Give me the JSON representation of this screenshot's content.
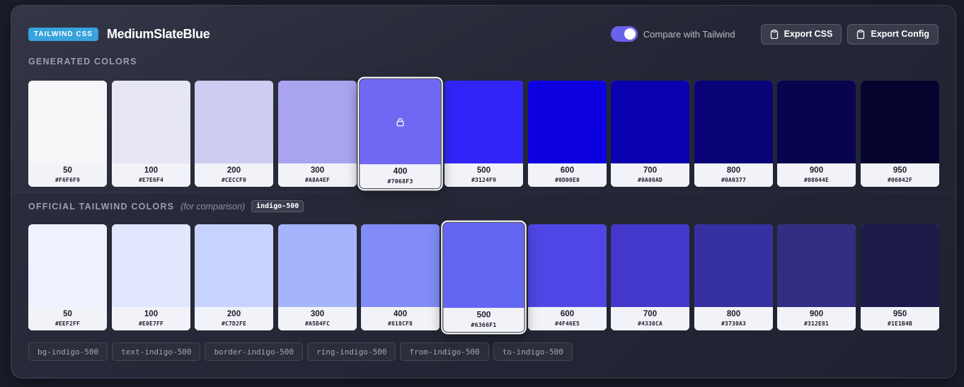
{
  "header": {
    "badge": "TAILWIND CSS",
    "title": "MediumSlateBlue",
    "toggle_label": "Compare with Tailwind",
    "toggle_on": true,
    "export_css": "Export CSS",
    "export_config": "Export Config"
  },
  "colors": {
    "accent": "#6a62ec",
    "badge": "#38a3dd"
  },
  "generated": {
    "label": "GENERATED COLORS",
    "swatches": [
      {
        "shade": "50",
        "hex": "#F6F6F9",
        "color": "#F6F6F9"
      },
      {
        "shade": "100",
        "hex": "#E7E6F4",
        "color": "#E7E6F4"
      },
      {
        "shade": "200",
        "hex": "#CECCF0",
        "color": "#CECCF0"
      },
      {
        "shade": "300",
        "hex": "#A8A4EF",
        "color": "#A8A4EF"
      },
      {
        "shade": "400",
        "hex": "#7068F3",
        "color": "#7068F3",
        "locked": true
      },
      {
        "shade": "500",
        "hex": "#3124F9",
        "color": "#3124F9"
      },
      {
        "shade": "600",
        "hex": "#0D00E0",
        "color": "#0D00E0"
      },
      {
        "shade": "700",
        "hex": "#0A00AD",
        "color": "#0A00AD"
      },
      {
        "shade": "800",
        "hex": "#0A0377",
        "color": "#0A0377"
      },
      {
        "shade": "900",
        "hex": "#08044E",
        "color": "#08044E"
      },
      {
        "shade": "950",
        "hex": "#06042F",
        "color": "#06042F"
      }
    ]
  },
  "official": {
    "label": "OFFICIAL TAILWIND COLORS",
    "note": "(for comparison)",
    "tag": "indigo-500",
    "swatches": [
      {
        "shade": "50",
        "hex": "#EEF2FF",
        "color": "#EEF2FF"
      },
      {
        "shade": "100",
        "hex": "#E0E7FF",
        "color": "#E0E7FF"
      },
      {
        "shade": "200",
        "hex": "#C7D2FE",
        "color": "#C7D2FE"
      },
      {
        "shade": "300",
        "hex": "#A5B4FC",
        "color": "#A5B4FC"
      },
      {
        "shade": "400",
        "hex": "#818CF8",
        "color": "#818CF8"
      },
      {
        "shade": "500",
        "hex": "#6366F1",
        "color": "#6366F1",
        "selected": true
      },
      {
        "shade": "600",
        "hex": "#4F46E5",
        "color": "#4F46E5"
      },
      {
        "shade": "700",
        "hex": "#4338CA",
        "color": "#4338CA"
      },
      {
        "shade": "800",
        "hex": "#3730A3",
        "color": "#3730A3"
      },
      {
        "shade": "900",
        "hex": "#312E81",
        "color": "#312E81"
      },
      {
        "shade": "950",
        "hex": "#1E1B4B",
        "color": "#1E1B4B"
      }
    ]
  },
  "chips": [
    "bg-indigo-500",
    "text-indigo-500",
    "border-indigo-500",
    "ring-indigo-500",
    "from-indigo-500",
    "to-indigo-500"
  ]
}
